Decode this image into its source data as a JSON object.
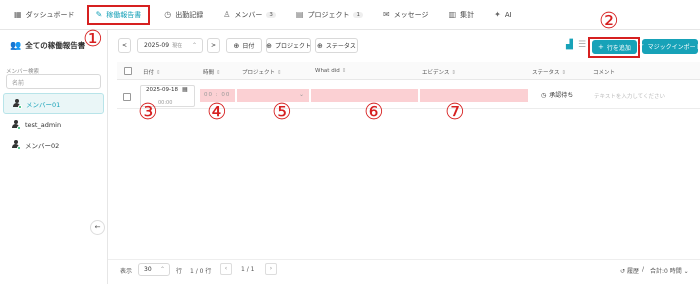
{
  "nav": {
    "items": [
      {
        "label": "ダッシュボード",
        "icon": "grid-icon"
      },
      {
        "label": "稼働報告書",
        "icon": "edit-icon",
        "active": true
      },
      {
        "label": "出勤記録",
        "icon": "clock-icon"
      },
      {
        "label": "メンバー",
        "icon": "user-icon",
        "count": "3"
      },
      {
        "label": "プロジェクト",
        "icon": "document-icon",
        "count": "1"
      },
      {
        "label": "メッセージ",
        "icon": "mail-icon"
      },
      {
        "label": "集計",
        "icon": "bar-chart-icon"
      },
      {
        "label": "AI",
        "icon": "ai-icon"
      }
    ]
  },
  "sidebar": {
    "title": "全ての稼働報告書",
    "search_label": "メンバー検索",
    "search_placeholder": "名前",
    "members": [
      {
        "label": "メンバー01",
        "selected": true
      },
      {
        "label": "test_admin"
      },
      {
        "label": "メンバー02"
      }
    ]
  },
  "toolbar": {
    "prev": "<",
    "month": "2025-09",
    "month_now": "現在",
    "next": ">",
    "date_btn": "日付",
    "project_btn": "プロジェクト",
    "status_btn": "ステータス",
    "add_row": "行を追加",
    "magic_import": "マジックインポート"
  },
  "table": {
    "headers": [
      "日付",
      "時間",
      "プロジェクト",
      "What did",
      "エビデンス",
      "ステータス",
      "コメント"
    ],
    "row": {
      "date": "2025-09-18",
      "time_hint": "00:00",
      "time_value": "00 : 00",
      "status": "承認待ち",
      "comment_placeholder": "テキストを入力してください"
    }
  },
  "annotations": [
    "①",
    "②",
    "③",
    "④",
    "⑤",
    "⑥",
    "⑦"
  ],
  "footer": {
    "display_label": "表示",
    "per_page": "30",
    "rows_label": "行",
    "range": "1 / 0 行",
    "page": "1 / 1",
    "history": "履歴",
    "total": "合計:0 時間"
  },
  "colors": {
    "accent": "#17a2b8",
    "highlight": "#d62020",
    "row_pink": "#fbd0d3"
  }
}
